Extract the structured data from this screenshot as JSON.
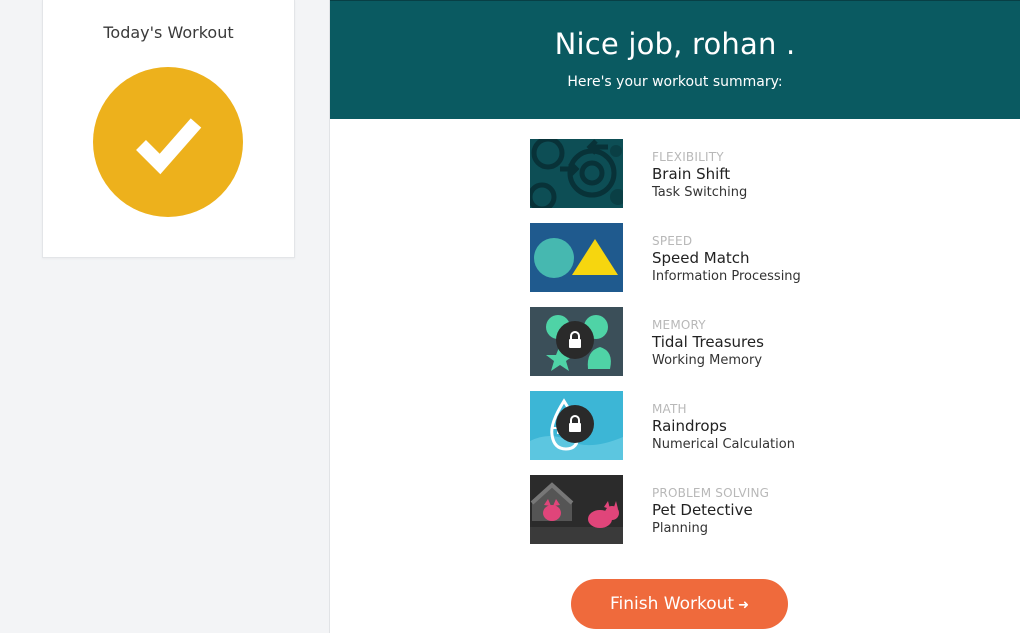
{
  "sidebar": {
    "card_title": "Today's Workout",
    "status_icon": "checkmark-icon",
    "status_color": "#edb11c"
  },
  "header": {
    "greeting": "Nice job, rohan .",
    "subtitle": "Here's your workout summary:",
    "background_color": "#0a5a61"
  },
  "games": [
    {
      "category": "FLEXIBILITY",
      "name": "Brain Shift",
      "skill": "Task Switching",
      "locked": false
    },
    {
      "category": "SPEED",
      "name": "Speed Match",
      "skill": "Information Processing",
      "locked": false
    },
    {
      "category": "MEMORY",
      "name": "Tidal Treasures",
      "skill": "Working Memory",
      "locked": true
    },
    {
      "category": "MATH",
      "name": "Raindrops",
      "skill": "Numerical Calculation",
      "locked": true
    },
    {
      "category": "PROBLEM SOLVING",
      "name": "Pet Detective",
      "skill": "Planning",
      "locked": false
    }
  ],
  "finish_button": {
    "label": "Finish Workout",
    "arrow": "➜",
    "color": "#ef6a3c"
  }
}
